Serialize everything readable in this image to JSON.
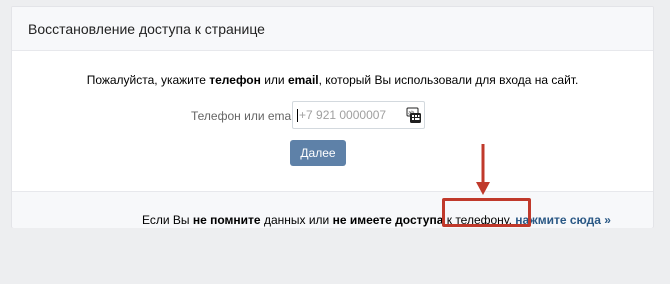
{
  "header": {
    "title": "Восстановление доступа к странице"
  },
  "form": {
    "instruction_parts": {
      "p1": "Пожалуйста, укажите ",
      "b1": "телефон",
      "p2": " или ",
      "b2": "email",
      "p3": ", который Вы использовали для входа на сайт."
    },
    "field_label": "Телефон или email",
    "input_value": "",
    "input_placeholder": "+7 921 0000007",
    "submit_label": "Далее"
  },
  "footer": {
    "parts": {
      "p1": "Если Вы ",
      "b1": "не помните",
      "p2": " данных или ",
      "b2": "не имеете доступа",
      "p3": " к телефону, "
    },
    "link_label": "нажмите сюда »"
  },
  "colors": {
    "page_background": "#edeef0",
    "button": "#5e81a8",
    "link": "#2a5885",
    "annotation": "#c0392b"
  },
  "icons": {
    "input_icon": "keyboard-layout-icon",
    "annotation_arrow": "arrow-down-icon"
  }
}
